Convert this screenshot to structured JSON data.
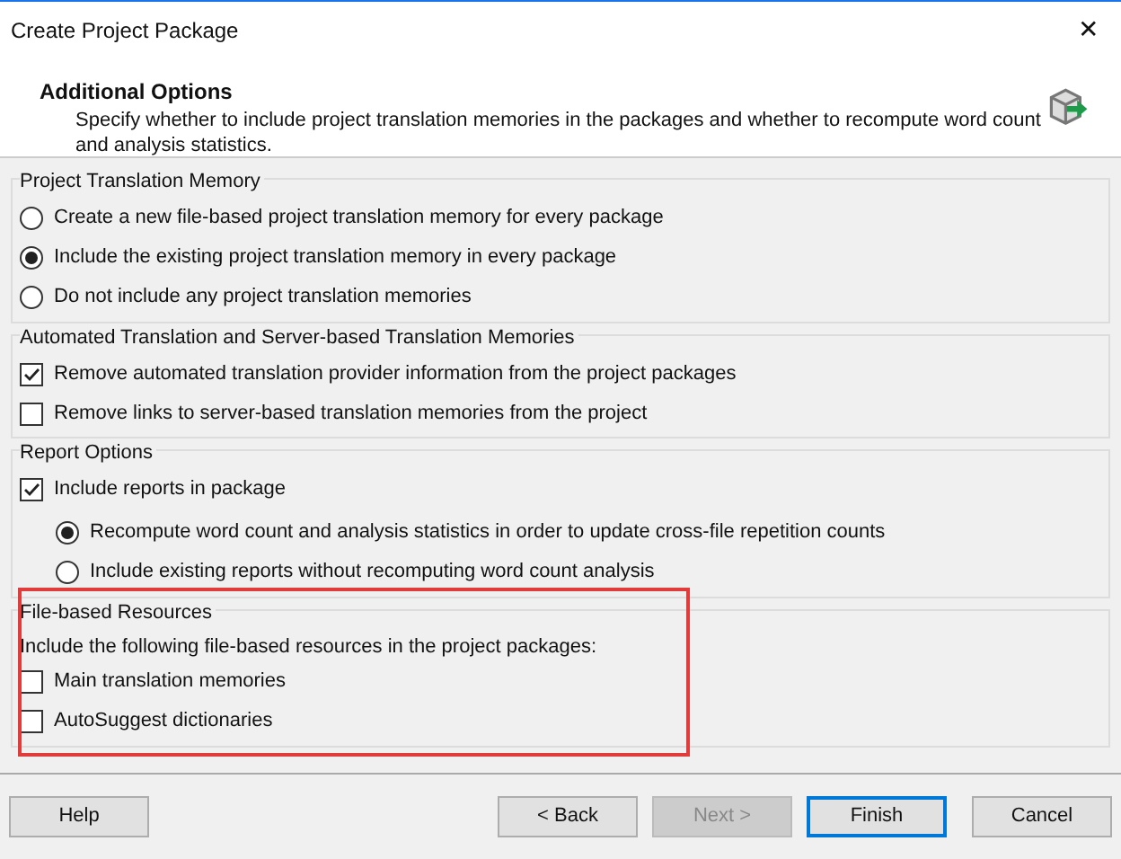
{
  "window": {
    "title": "Create Project Package",
    "close": "✕"
  },
  "header": {
    "title": "Additional Options",
    "description": "Specify whether to include project translation memories in the packages and whether to recompute word count and analysis statistics."
  },
  "groups": [
    {
      "title": "Project Translation Memory",
      "options": [
        {
          "kind": "radio",
          "label": "Create a new file-based project translation memory for every package",
          "selected": false
        },
        {
          "kind": "radio",
          "label": "Include the existing project translation memory in every package",
          "selected": true
        },
        {
          "kind": "radio",
          "label": "Do not include any project translation memories",
          "selected": false
        }
      ]
    },
    {
      "title": "Automated Translation and Server-based Translation Memories",
      "options": [
        {
          "kind": "checkbox",
          "label": "Remove automated translation provider information from the project packages",
          "checked": true
        },
        {
          "kind": "checkbox",
          "label": "Remove links to server-based translation memories from the project",
          "checked": false
        }
      ]
    },
    {
      "title": "Report Options",
      "options": [
        {
          "kind": "checkbox",
          "label": "Include reports in package",
          "checked": true,
          "children": [
            {
              "kind": "radio",
              "label": "Recompute word count and analysis statistics in order to update cross-file repetition counts",
              "selected": true
            },
            {
              "kind": "radio",
              "label": "Include existing reports without recomputing word count analysis",
              "selected": false
            }
          ]
        }
      ]
    },
    {
      "title": "File-based Resources",
      "highlighted": true,
      "intro": "Include the following file-based resources in the project packages:",
      "options": [
        {
          "kind": "checkbox",
          "label": "Main translation memories",
          "checked": false
        },
        {
          "kind": "checkbox",
          "label": "AutoSuggest dictionaries",
          "checked": false
        }
      ]
    }
  ],
  "buttons": [
    {
      "label": "Help",
      "disabled": false,
      "default": false
    },
    {
      "label": "< Back",
      "disabled": false,
      "default": false
    },
    {
      "label": "Next >",
      "disabled": true,
      "default": false
    },
    {
      "label": "Finish",
      "disabled": false,
      "default": true
    },
    {
      "label": "Cancel",
      "disabled": false,
      "default": false
    }
  ]
}
